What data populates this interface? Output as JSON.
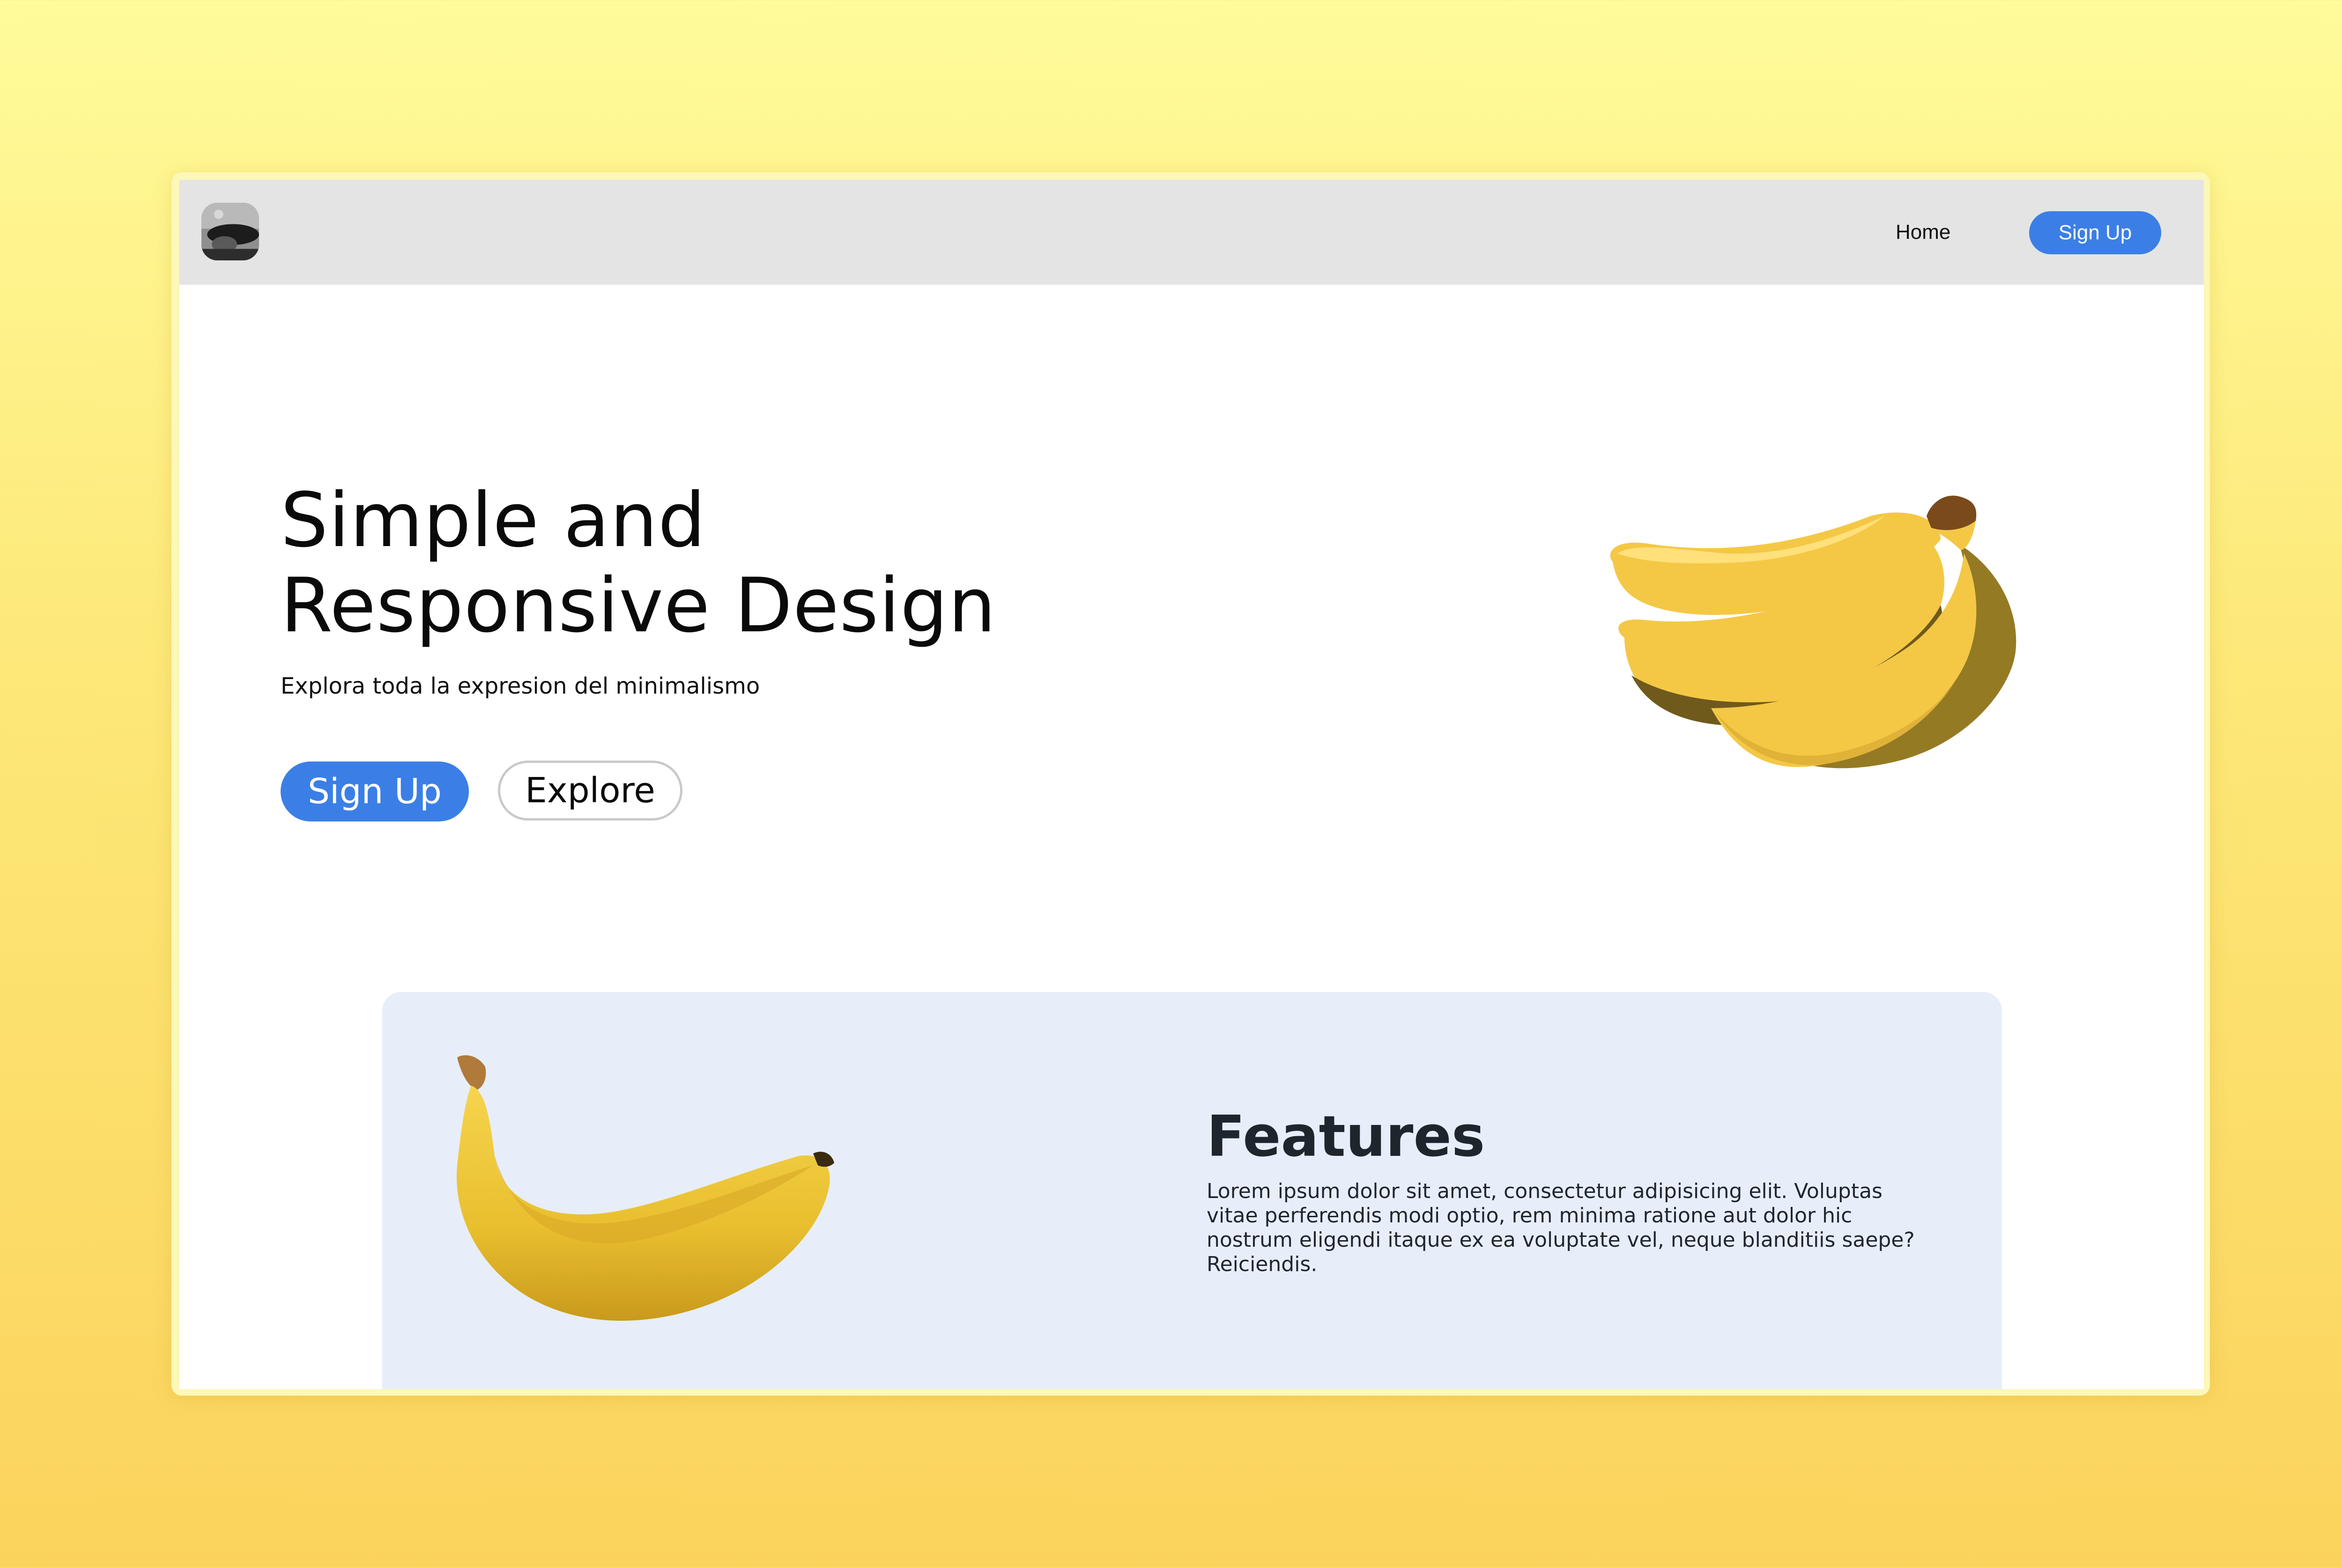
{
  "navbar": {
    "logo_icon": "profile-avatar-icon",
    "home_label": "Home",
    "signup_label": "Sign Up"
  },
  "hero": {
    "title_line1": "Simple and",
    "title_line2": "Responsive Design",
    "subtitle": "Explora toda la expresion del minimalismo",
    "signup_label": "Sign Up",
    "explore_label": "Explore",
    "image_icon": "banana-bunch-illustration"
  },
  "features": {
    "title": "Features",
    "body": "Lorem ipsum dolor sit amet, consectetur adipisicing elit. Voluptas vitae perferendis modi optio, rem minima ratione aut dolor hic nostrum eligendi itaque ex ea voluptate vel, neque blanditiis saepe? Reiciendis.",
    "image_icon": "banana-photo"
  },
  "colors": {
    "accent": "#3b7fe6",
    "navbar_bg": "#e4e4e4",
    "card_bg": "#e7eefa",
    "page_bg_top": "#fffb9a",
    "page_bg_bottom": "#fbd35c",
    "banana_yellow": "#f4c845",
    "banana_shadow": "#957a24"
  }
}
